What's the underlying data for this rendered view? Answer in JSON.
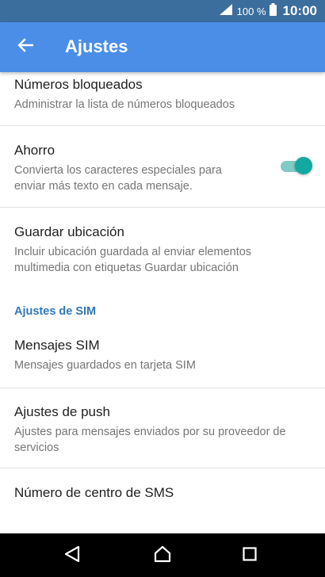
{
  "status_bar": {
    "battery_percent": "100 %",
    "time": "10:00"
  },
  "app_bar": {
    "title": "Ajustes"
  },
  "settings": {
    "blocked_numbers": {
      "title": "Números bloqueados",
      "summary": "Administrar la lista de números bloqueados"
    },
    "saving": {
      "title": "Ahorro",
      "summary_line1": "Convierta los caracteres especiales para",
      "summary_line2": "enviar más texto en cada mensaje.",
      "enabled": true
    },
    "save_location": {
      "title": "Guardar ubicación",
      "summary_line1": "Incluir ubicación guardada al enviar elementos",
      "summary_line2": "multimedia con etiquetas Guardar ubicación"
    },
    "sim_section_header": "Ajustes de SIM",
    "sim_messages": {
      "title": "Mensajes SIM",
      "summary": "Mensajes guardados en tarjeta SIM"
    },
    "push_settings": {
      "title": "Ajustes de push",
      "summary_line1": "Ajustes para mensajes enviados por su proveedor de",
      "summary_line2": "servicios"
    },
    "sms_center": {
      "title": "Número de centro de SMS"
    }
  },
  "colors": {
    "status_bar": "#3b6e9c",
    "app_bar": "#4a8ee8",
    "accent": "#13a8a0",
    "section_header": "#2f78b8"
  },
  "icons": {
    "back": "arrow-left-icon",
    "signal": "signal-icon",
    "battery": "battery-icon",
    "nav_back": "nav-back-icon",
    "nav_home": "nav-home-icon",
    "nav_recents": "nav-recents-icon"
  }
}
